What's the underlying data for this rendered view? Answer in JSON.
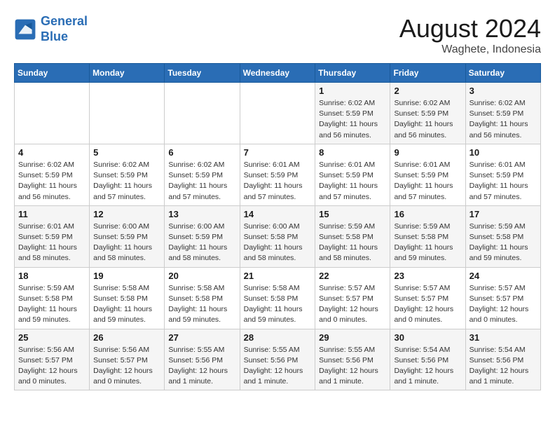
{
  "header": {
    "logo_line1": "General",
    "logo_line2": "Blue",
    "month": "August 2024",
    "location": "Waghete, Indonesia"
  },
  "days_of_week": [
    "Sunday",
    "Monday",
    "Tuesday",
    "Wednesday",
    "Thursday",
    "Friday",
    "Saturday"
  ],
  "weeks": [
    [
      {
        "day": "",
        "info": ""
      },
      {
        "day": "",
        "info": ""
      },
      {
        "day": "",
        "info": ""
      },
      {
        "day": "",
        "info": ""
      },
      {
        "day": "1",
        "info": "Sunrise: 6:02 AM\nSunset: 5:59 PM\nDaylight: 11 hours and 56 minutes."
      },
      {
        "day": "2",
        "info": "Sunrise: 6:02 AM\nSunset: 5:59 PM\nDaylight: 11 hours and 56 minutes."
      },
      {
        "day": "3",
        "info": "Sunrise: 6:02 AM\nSunset: 5:59 PM\nDaylight: 11 hours and 56 minutes."
      }
    ],
    [
      {
        "day": "4",
        "info": "Sunrise: 6:02 AM\nSunset: 5:59 PM\nDaylight: 11 hours and 56 minutes."
      },
      {
        "day": "5",
        "info": "Sunrise: 6:02 AM\nSunset: 5:59 PM\nDaylight: 11 hours and 57 minutes."
      },
      {
        "day": "6",
        "info": "Sunrise: 6:02 AM\nSunset: 5:59 PM\nDaylight: 11 hours and 57 minutes."
      },
      {
        "day": "7",
        "info": "Sunrise: 6:01 AM\nSunset: 5:59 PM\nDaylight: 11 hours and 57 minutes."
      },
      {
        "day": "8",
        "info": "Sunrise: 6:01 AM\nSunset: 5:59 PM\nDaylight: 11 hours and 57 minutes."
      },
      {
        "day": "9",
        "info": "Sunrise: 6:01 AM\nSunset: 5:59 PM\nDaylight: 11 hours and 57 minutes."
      },
      {
        "day": "10",
        "info": "Sunrise: 6:01 AM\nSunset: 5:59 PM\nDaylight: 11 hours and 57 minutes."
      }
    ],
    [
      {
        "day": "11",
        "info": "Sunrise: 6:01 AM\nSunset: 5:59 PM\nDaylight: 11 hours and 58 minutes."
      },
      {
        "day": "12",
        "info": "Sunrise: 6:00 AM\nSunset: 5:59 PM\nDaylight: 11 hours and 58 minutes."
      },
      {
        "day": "13",
        "info": "Sunrise: 6:00 AM\nSunset: 5:59 PM\nDaylight: 11 hours and 58 minutes."
      },
      {
        "day": "14",
        "info": "Sunrise: 6:00 AM\nSunset: 5:58 PM\nDaylight: 11 hours and 58 minutes."
      },
      {
        "day": "15",
        "info": "Sunrise: 5:59 AM\nSunset: 5:58 PM\nDaylight: 11 hours and 58 minutes."
      },
      {
        "day": "16",
        "info": "Sunrise: 5:59 AM\nSunset: 5:58 PM\nDaylight: 11 hours and 59 minutes."
      },
      {
        "day": "17",
        "info": "Sunrise: 5:59 AM\nSunset: 5:58 PM\nDaylight: 11 hours and 59 minutes."
      }
    ],
    [
      {
        "day": "18",
        "info": "Sunrise: 5:59 AM\nSunset: 5:58 PM\nDaylight: 11 hours and 59 minutes."
      },
      {
        "day": "19",
        "info": "Sunrise: 5:58 AM\nSunset: 5:58 PM\nDaylight: 11 hours and 59 minutes."
      },
      {
        "day": "20",
        "info": "Sunrise: 5:58 AM\nSunset: 5:58 PM\nDaylight: 11 hours and 59 minutes."
      },
      {
        "day": "21",
        "info": "Sunrise: 5:58 AM\nSunset: 5:58 PM\nDaylight: 11 hours and 59 minutes."
      },
      {
        "day": "22",
        "info": "Sunrise: 5:57 AM\nSunset: 5:57 PM\nDaylight: 12 hours and 0 minutes."
      },
      {
        "day": "23",
        "info": "Sunrise: 5:57 AM\nSunset: 5:57 PM\nDaylight: 12 hours and 0 minutes."
      },
      {
        "day": "24",
        "info": "Sunrise: 5:57 AM\nSunset: 5:57 PM\nDaylight: 12 hours and 0 minutes."
      }
    ],
    [
      {
        "day": "25",
        "info": "Sunrise: 5:56 AM\nSunset: 5:57 PM\nDaylight: 12 hours and 0 minutes."
      },
      {
        "day": "26",
        "info": "Sunrise: 5:56 AM\nSunset: 5:57 PM\nDaylight: 12 hours and 0 minutes."
      },
      {
        "day": "27",
        "info": "Sunrise: 5:55 AM\nSunset: 5:56 PM\nDaylight: 12 hours and 1 minute."
      },
      {
        "day": "28",
        "info": "Sunrise: 5:55 AM\nSunset: 5:56 PM\nDaylight: 12 hours and 1 minute."
      },
      {
        "day": "29",
        "info": "Sunrise: 5:55 AM\nSunset: 5:56 PM\nDaylight: 12 hours and 1 minute."
      },
      {
        "day": "30",
        "info": "Sunrise: 5:54 AM\nSunset: 5:56 PM\nDaylight: 12 hours and 1 minute."
      },
      {
        "day": "31",
        "info": "Sunrise: 5:54 AM\nSunset: 5:56 PM\nDaylight: 12 hours and 1 minute."
      }
    ]
  ]
}
